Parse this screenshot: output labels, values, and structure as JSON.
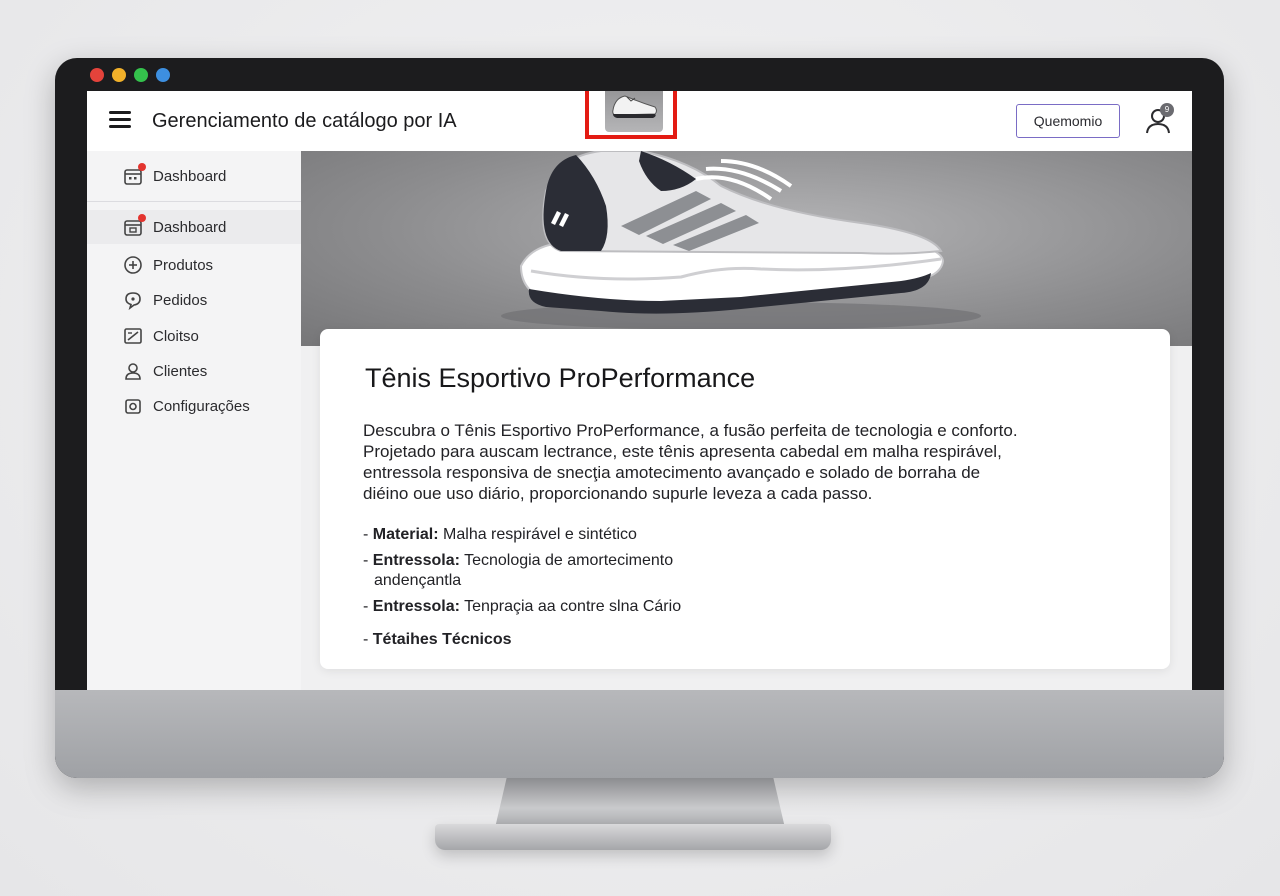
{
  "app": {
    "title": "Gerenciamento de catálogo por IA",
    "action_button": "Quemomio",
    "user_badge": "9"
  },
  "sidebar": {
    "items": [
      {
        "label": "Dashboard",
        "icon": "calendar-icon"
      },
      {
        "label": "Dashboard",
        "icon": "calendar-icon"
      },
      {
        "label": "Produtos",
        "icon": "plus-circle-icon"
      },
      {
        "label": "Pedidos",
        "icon": "chat-icon"
      },
      {
        "label": "Cloitso",
        "icon": "edit-box-icon"
      },
      {
        "label": "Clientes",
        "icon": "users-icon"
      },
      {
        "label": "Configurações",
        "icon": "camera-icon"
      }
    ]
  },
  "product": {
    "title": "Tênis Esportivo ProPerformance",
    "description_lines": [
      "Descubra o Tênis Esportivo ProPerformance, a fusão perfeita de tecnologia e conforto.",
      "Projetado para auscam lectrance, este tênis apresenta cabedal em malha respirável,",
      "entressola responsiva de snecţia amotecimento avançado e solado de borraha de",
      "diéino oue uso diário, proporcionando supurle leveza a cada passo."
    ],
    "specs": [
      {
        "label": "Material:",
        "value": "Malha respirável e sintético",
        "cont": ""
      },
      {
        "label": "Entressola:",
        "value": "Tecnologia de amortecimento",
        "cont": "andençantla"
      },
      {
        "label": "Entressola:",
        "value": "Tenpraçia aa contre slna Cário",
        "cont": ""
      },
      {
        "label": "Tétaihes Técnicos",
        "value": "",
        "cont": ""
      }
    ]
  },
  "colors": {
    "highlight_box": "#e31b13",
    "button_border": "#7a6cc5",
    "notification": "#e3342f"
  }
}
